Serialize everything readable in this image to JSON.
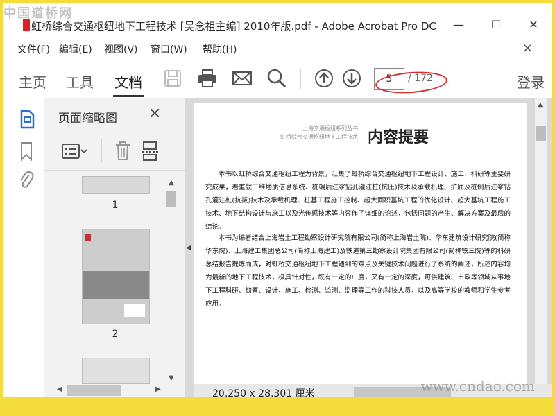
{
  "watermark": {
    "top_left": "中国道桥网",
    "bottom_right": "www.cndao.com"
  },
  "window": {
    "title": "虹桥综合交通枢纽地下工程技术 [吴念祖主编] 2010年版.pdf - Adobe Acrobat Pro DC",
    "minimize": "—",
    "maximize": "☐",
    "close": "✕"
  },
  "menu": {
    "items": [
      "文件(F)",
      "编辑(E)",
      "视图(V)",
      "窗口(W)",
      "帮助(H)"
    ],
    "close": "×"
  },
  "toolbar": {
    "tabs": [
      "主页",
      "工具",
      "文档"
    ],
    "active_tab": "文档",
    "page_current": "5",
    "page_total": "/ 172",
    "login": "登录"
  },
  "thumbnails": {
    "title": "页面缩略图",
    "close": "✕",
    "pages": [
      {
        "label": "1"
      },
      {
        "label": "2"
      }
    ]
  },
  "document": {
    "series": [
      "上海交通枢纽系列丛书",
      "虹桥综合交通枢纽地下工程技术"
    ],
    "heading": "内容提要",
    "paragraphs": [
      "本书以虹桥综合交通枢纽工程为背景，汇集了虹桥综合交通枢纽地下工程设计、施工、科研等主要研究成果，着重就三维地质信息系统、桩端后注浆钻孔灌注桩(抗压)技术及承载机理、扩底及桩侧后注浆钻孔灌注桩(抗拔)技术及承载机理、桩基工程施工控制、超大面积基坑工程的优化设计、超大基坑工程施工技术、地下结构设计与施工以及光传感技术等内容作了详细的论述，包括问题的产生、解决方案及最后的结论。",
      "本书为编者结合上海岩土工程勘察设计研究院有限公司(简称上海岩土院)、华东建筑设计研究院(简称华东院)、上海建工集团总公司(简称上海建工)及铁道第三勘察设计院集团有限公司(简称铁三院)等的科研总结报告提炼而成，对虹桥交通枢纽地下工程遇到的难点及关键技术问题进行了系统的阐述，所述内容均为最新的地下工程技术，极具针对性，既有一定的广度，又有一定的深度，可供建筑、市政等领域从事地下工程科研、勘察、设计、施工、检测、监测、监理等工作的科技人员，以及高等学校的教师和学生参考应用。"
    ]
  },
  "status": {
    "dimensions": "20.250 x 28.301 厘米"
  },
  "colors": {
    "background": "#f3dc3c",
    "accent_blue": "#2b6fd6",
    "annotation_red": "#d83030"
  }
}
